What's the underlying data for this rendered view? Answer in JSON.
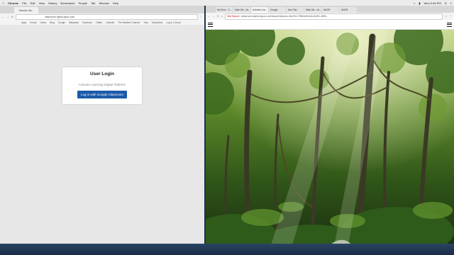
{
  "menubar": {
    "app": "Chrome",
    "items": [
      "File",
      "Edit",
      "View",
      "History",
      "Bookmarks",
      "People",
      "Tab",
      "Window",
      "Help"
    ],
    "clock": "Wed 3:46 PM"
  },
  "left_browser": {
    "tab_label": "Tutorial / Bo...",
    "address": "classroom.alpha-lqsoc.com",
    "bookmarks": [
      "Apps",
      "iCloud",
      "Yahoo",
      "Bing",
      "Google",
      "Wikipedia",
      "Facebook",
      "Twitter",
      "LinkedIn",
      "The Weather Channel",
      "Yelp",
      "TripAdvisor",
      "Log in | iCloud"
    ],
    "login": {
      "title": "User Login",
      "subtitle": "Activate Learning Digital Platform",
      "button": "Log in with Google Classroom"
    }
  },
  "right_browser": {
    "tabs": [
      "My Drive - G...",
      "Math 6th - Un...",
      "Activate Lea...",
      "Google",
      "New Tab",
      "Math 6th - Un...",
      "ANGR",
      "ANGR"
    ],
    "security_label": "Not Secure",
    "address": "classroom.alpha-lqsoc.com/lesson/lessons.html?id=755ebbfe3c4c3e3f1-489b..."
  },
  "colors": {
    "login_button": "#1a5aa8",
    "desktop": "#1f3350"
  }
}
